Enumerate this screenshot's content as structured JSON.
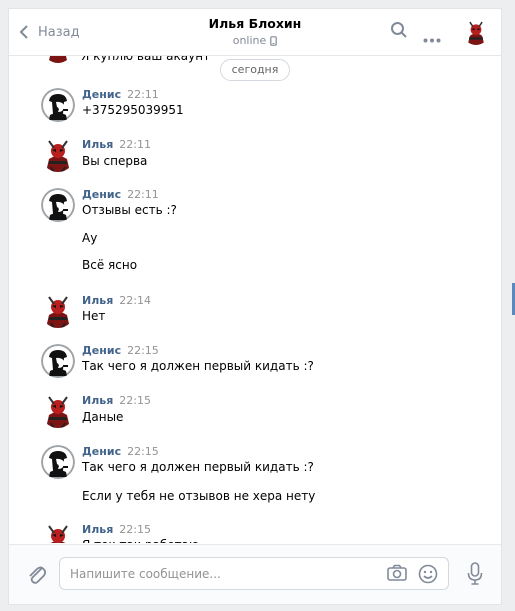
{
  "header": {
    "back_label": "Назад",
    "title": "Илья Блохин",
    "status": "online"
  },
  "date_divider": "сегодня",
  "partial_top_text": "Я куплю ваш акаунт",
  "messages": [
    {
      "author": "Денис",
      "time": "22:11",
      "avatar": "sherlock",
      "lines": [
        "+375295039951"
      ]
    },
    {
      "author": "Илья",
      "time": "22:11",
      "avatar": "deadpool",
      "lines": [
        "Вы сперва"
      ]
    },
    {
      "author": "Денис",
      "time": "22:11",
      "avatar": "sherlock",
      "lines": [
        "Отзывы есть :?",
        "Ау",
        "Всё ясно"
      ]
    },
    {
      "author": "Илья",
      "time": "22:14",
      "avatar": "deadpool",
      "lines": [
        "Нет"
      ]
    },
    {
      "author": "Денис",
      "time": "22:15",
      "avatar": "sherlock",
      "lines": [
        "Так чего я должен первый кидать :?"
      ]
    },
    {
      "author": "Илья",
      "time": "22:15",
      "avatar": "deadpool",
      "lines": [
        "Даные"
      ]
    },
    {
      "author": "Денис",
      "time": "22:15",
      "avatar": "sherlock",
      "lines": [
        "Так чего я должен первый кидать :?",
        "Если у тебя не отзывов не хера нету"
      ]
    },
    {
      "author": "Илья",
      "time": "22:15",
      "avatar": "deadpool",
      "lines": [
        "Я ток так работаю"
      ]
    }
  ],
  "composer": {
    "placeholder": "Напишите сообщение..."
  },
  "colors": {
    "author": "#42648b",
    "time": "#939393",
    "icon": "#828a99",
    "background": "#edeef0"
  },
  "icons": [
    "back-arrow-icon",
    "phone-icon",
    "search-icon",
    "more-icon",
    "paperclip-icon",
    "camera-icon",
    "smile-icon",
    "microphone-icon"
  ]
}
